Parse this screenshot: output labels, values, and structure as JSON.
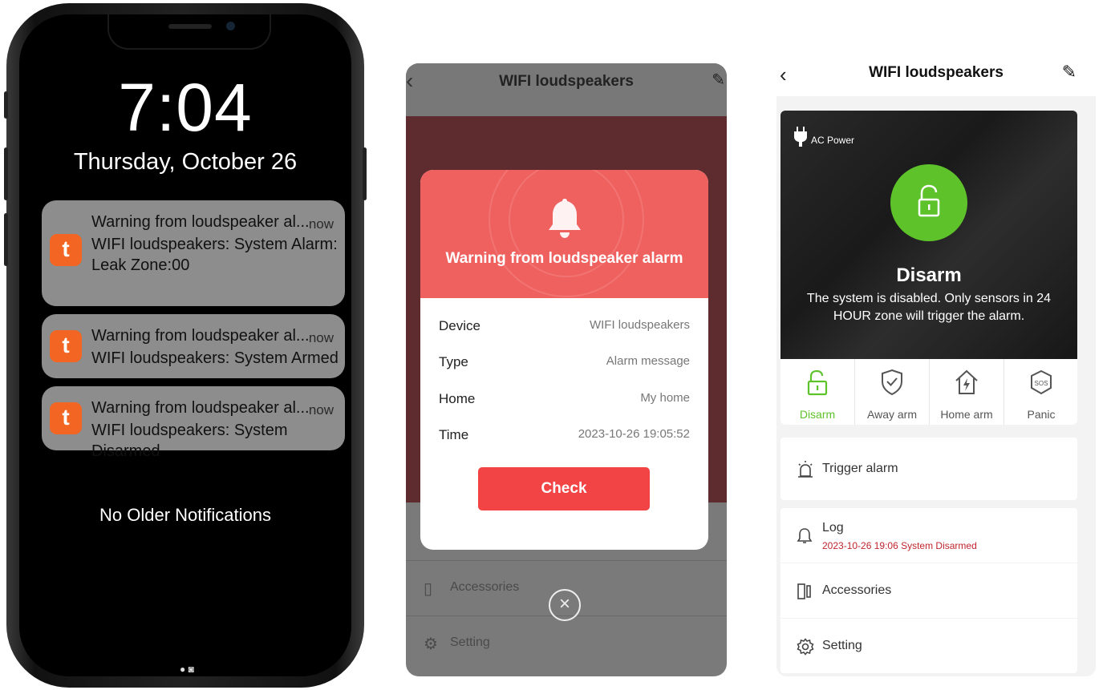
{
  "lock_screen": {
    "time": "7:04",
    "date": "Thursday, October 26",
    "notifications": [
      {
        "title": "Warning from loudspeaker al...",
        "time": "now",
        "body_line1": "WIFI loudspeakers: System Alarm:",
        "body_line2": "Leak Zone:00"
      },
      {
        "title": "Warning from loudspeaker al...",
        "time": "now",
        "body_line1": "WIFI loudspeakers: System Armed"
      },
      {
        "title": "Warning from loudspeaker al...",
        "time": "now",
        "body_line1": "WIFI loudspeakers: System Disarmed"
      }
    ],
    "app_icon_letter": "t",
    "footer": "No Older Notifications"
  },
  "alarm_popup_screen": {
    "header_title": "WIFI loudspeakers",
    "modal": {
      "title": "Warning from loudspeaker alarm",
      "rows": [
        {
          "key": "Device",
          "value": "WIFI loudspeakers"
        },
        {
          "key": "Type",
          "value": "Alarm message"
        },
        {
          "key": "Home",
          "value": "My home"
        },
        {
          "key": "Time",
          "value": "2023-10-26 19:05:52"
        }
      ],
      "button": "Check"
    },
    "background_items": [
      "Accessories",
      "Setting"
    ],
    "accent_color": "#ef615f"
  },
  "device_screen": {
    "header_title": "WIFI loudspeakers",
    "power_label": "AC Power",
    "state": "Disarm",
    "description": "The system is disabled. Only sensors in 24 HOUR zone will trigger the alarm.",
    "modes": [
      {
        "label": "Disarm",
        "icon": "unlock-icon",
        "active": true
      },
      {
        "label": "Away arm",
        "icon": "shield-check-icon",
        "active": false
      },
      {
        "label": "Home arm",
        "icon": "home-bolt-icon",
        "active": false
      },
      {
        "label": "Panic",
        "icon": "sos-icon",
        "active": false
      }
    ],
    "menu": {
      "trigger": "Trigger alarm",
      "log_label": "Log",
      "log_entry": "2023-10-26 19:06 System Disarmed",
      "accessories": "Accessories",
      "setting": "Setting"
    },
    "active_color": "#5ec22a",
    "log_color": "#c0262d"
  }
}
